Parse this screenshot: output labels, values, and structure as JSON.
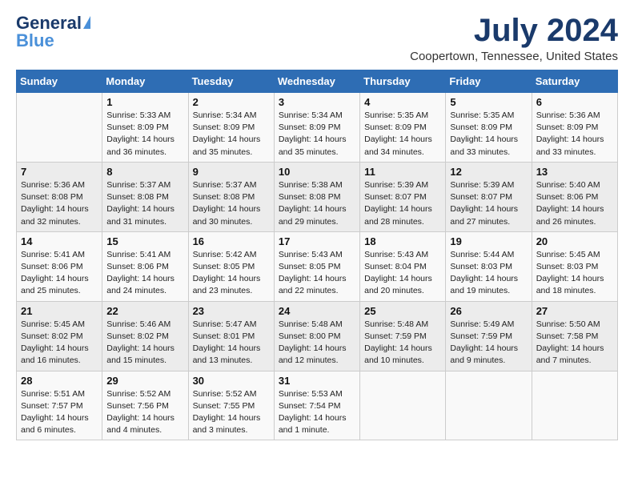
{
  "header": {
    "logo_general": "General",
    "logo_blue": "Blue",
    "month_title": "July 2024",
    "location": "Coopertown, Tennessee, United States"
  },
  "weekdays": [
    "Sunday",
    "Monday",
    "Tuesday",
    "Wednesday",
    "Thursday",
    "Friday",
    "Saturday"
  ],
  "weeks": [
    [
      {
        "day": "",
        "info": ""
      },
      {
        "day": "1",
        "info": "Sunrise: 5:33 AM\nSunset: 8:09 PM\nDaylight: 14 hours\nand 36 minutes."
      },
      {
        "day": "2",
        "info": "Sunrise: 5:34 AM\nSunset: 8:09 PM\nDaylight: 14 hours\nand 35 minutes."
      },
      {
        "day": "3",
        "info": "Sunrise: 5:34 AM\nSunset: 8:09 PM\nDaylight: 14 hours\nand 35 minutes."
      },
      {
        "day": "4",
        "info": "Sunrise: 5:35 AM\nSunset: 8:09 PM\nDaylight: 14 hours\nand 34 minutes."
      },
      {
        "day": "5",
        "info": "Sunrise: 5:35 AM\nSunset: 8:09 PM\nDaylight: 14 hours\nand 33 minutes."
      },
      {
        "day": "6",
        "info": "Sunrise: 5:36 AM\nSunset: 8:09 PM\nDaylight: 14 hours\nand 33 minutes."
      }
    ],
    [
      {
        "day": "7",
        "info": "Sunrise: 5:36 AM\nSunset: 8:08 PM\nDaylight: 14 hours\nand 32 minutes."
      },
      {
        "day": "8",
        "info": "Sunrise: 5:37 AM\nSunset: 8:08 PM\nDaylight: 14 hours\nand 31 minutes."
      },
      {
        "day": "9",
        "info": "Sunrise: 5:37 AM\nSunset: 8:08 PM\nDaylight: 14 hours\nand 30 minutes."
      },
      {
        "day": "10",
        "info": "Sunrise: 5:38 AM\nSunset: 8:08 PM\nDaylight: 14 hours\nand 29 minutes."
      },
      {
        "day": "11",
        "info": "Sunrise: 5:39 AM\nSunset: 8:07 PM\nDaylight: 14 hours\nand 28 minutes."
      },
      {
        "day": "12",
        "info": "Sunrise: 5:39 AM\nSunset: 8:07 PM\nDaylight: 14 hours\nand 27 minutes."
      },
      {
        "day": "13",
        "info": "Sunrise: 5:40 AM\nSunset: 8:06 PM\nDaylight: 14 hours\nand 26 minutes."
      }
    ],
    [
      {
        "day": "14",
        "info": "Sunrise: 5:41 AM\nSunset: 8:06 PM\nDaylight: 14 hours\nand 25 minutes."
      },
      {
        "day": "15",
        "info": "Sunrise: 5:41 AM\nSunset: 8:06 PM\nDaylight: 14 hours\nand 24 minutes."
      },
      {
        "day": "16",
        "info": "Sunrise: 5:42 AM\nSunset: 8:05 PM\nDaylight: 14 hours\nand 23 minutes."
      },
      {
        "day": "17",
        "info": "Sunrise: 5:43 AM\nSunset: 8:05 PM\nDaylight: 14 hours\nand 22 minutes."
      },
      {
        "day": "18",
        "info": "Sunrise: 5:43 AM\nSunset: 8:04 PM\nDaylight: 14 hours\nand 20 minutes."
      },
      {
        "day": "19",
        "info": "Sunrise: 5:44 AM\nSunset: 8:03 PM\nDaylight: 14 hours\nand 19 minutes."
      },
      {
        "day": "20",
        "info": "Sunrise: 5:45 AM\nSunset: 8:03 PM\nDaylight: 14 hours\nand 18 minutes."
      }
    ],
    [
      {
        "day": "21",
        "info": "Sunrise: 5:45 AM\nSunset: 8:02 PM\nDaylight: 14 hours\nand 16 minutes."
      },
      {
        "day": "22",
        "info": "Sunrise: 5:46 AM\nSunset: 8:02 PM\nDaylight: 14 hours\nand 15 minutes."
      },
      {
        "day": "23",
        "info": "Sunrise: 5:47 AM\nSunset: 8:01 PM\nDaylight: 14 hours\nand 13 minutes."
      },
      {
        "day": "24",
        "info": "Sunrise: 5:48 AM\nSunset: 8:00 PM\nDaylight: 14 hours\nand 12 minutes."
      },
      {
        "day": "25",
        "info": "Sunrise: 5:48 AM\nSunset: 7:59 PM\nDaylight: 14 hours\nand 10 minutes."
      },
      {
        "day": "26",
        "info": "Sunrise: 5:49 AM\nSunset: 7:59 PM\nDaylight: 14 hours\nand 9 minutes."
      },
      {
        "day": "27",
        "info": "Sunrise: 5:50 AM\nSunset: 7:58 PM\nDaylight: 14 hours\nand 7 minutes."
      }
    ],
    [
      {
        "day": "28",
        "info": "Sunrise: 5:51 AM\nSunset: 7:57 PM\nDaylight: 14 hours\nand 6 minutes."
      },
      {
        "day": "29",
        "info": "Sunrise: 5:52 AM\nSunset: 7:56 PM\nDaylight: 14 hours\nand 4 minutes."
      },
      {
        "day": "30",
        "info": "Sunrise: 5:52 AM\nSunset: 7:55 PM\nDaylight: 14 hours\nand 3 minutes."
      },
      {
        "day": "31",
        "info": "Sunrise: 5:53 AM\nSunset: 7:54 PM\nDaylight: 14 hours\nand 1 minute."
      },
      {
        "day": "",
        "info": ""
      },
      {
        "day": "",
        "info": ""
      },
      {
        "day": "",
        "info": ""
      }
    ]
  ]
}
